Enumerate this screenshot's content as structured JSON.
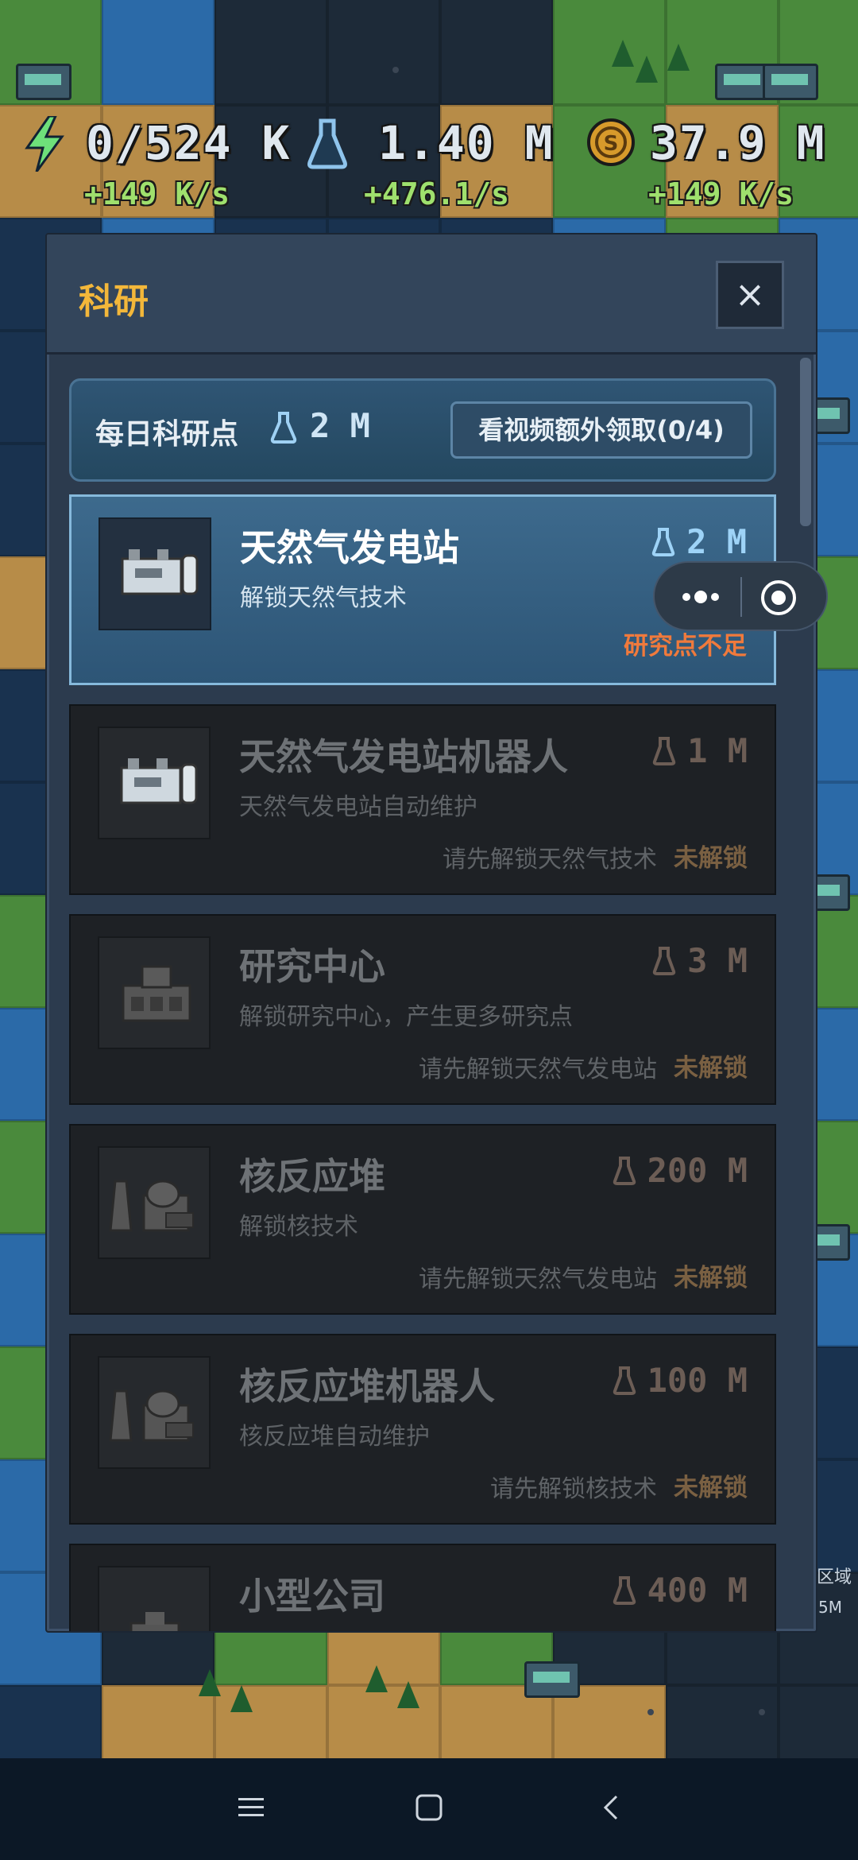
{
  "hud": {
    "power": "0/524 K",
    "power_rate": "+149 K/s",
    "research": "1.40 M",
    "research_rate": "+476.1/s",
    "money": "37.9 M",
    "money_rate": "+149 K/s"
  },
  "modal": {
    "title": "科研",
    "close_label": "×",
    "daily": {
      "label": "每日科研点",
      "value": "2 M",
      "button": "看视频额外领取(0/4)"
    },
    "items": [
      {
        "title": "天然气发电站",
        "cost": "2 M",
        "desc": "解锁天然气技术",
        "req": "",
        "status": "研究点不足",
        "icon": "gas-plant-icon"
      },
      {
        "title": "天然气发电站机器人",
        "cost": "1 M",
        "desc": "天然气发电站自动维护",
        "req": "请先解锁天然气技术",
        "status": "未解锁",
        "icon": "gas-plant-icon"
      },
      {
        "title": "研究中心",
        "cost": "3 M",
        "desc": "解锁研究中心，产生更多研究点",
        "req": "请先解锁天然气发电站",
        "status": "未解锁",
        "icon": "research-center-icon"
      },
      {
        "title": "核反应堆",
        "cost": "200 M",
        "desc": "解锁核技术",
        "req": "请先解锁天然气发电站",
        "status": "未解锁",
        "icon": "nuclear-reactor-icon"
      },
      {
        "title": "核反应堆机器人",
        "cost": "100 M",
        "desc": "核反应堆自动维护",
        "req": "请先解锁核技术",
        "status": "未解锁",
        "icon": "nuclear-reactor-icon"
      },
      {
        "title": "小型公司",
        "cost": "400 M",
        "desc": "",
        "req": "",
        "status": "",
        "icon": "company-icon"
      }
    ]
  },
  "side_labels": {
    "area": "区域",
    "value": "5M"
  }
}
